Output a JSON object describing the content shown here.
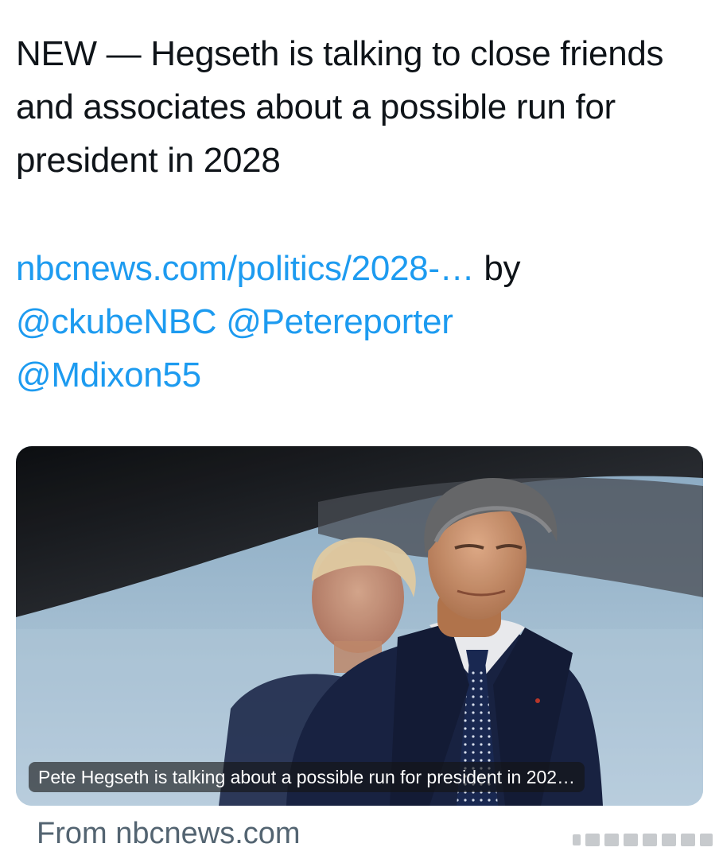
{
  "tweet": {
    "text": "NEW — Hegseth is talking to close friends and associates about a possible run for president in 2028",
    "link_text": "nbcnews.com/politics/2028-…",
    "by_label": " by ",
    "mentions": [
      "@ckubeNBC",
      "@Petereporter",
      "@Mdixon55"
    ]
  },
  "card": {
    "image_caption": "Pete Hegseth is talking about a possible run for president in 202…",
    "source": "From nbcnews.com"
  },
  "colors": {
    "link": "#1d9bf0",
    "text": "#0f1419",
    "muted": "#536471"
  }
}
